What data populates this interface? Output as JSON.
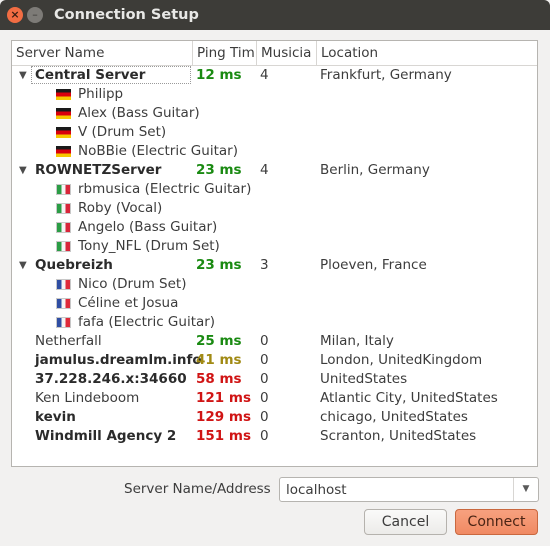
{
  "window": {
    "title": "Connection Setup",
    "close_glyph": "×",
    "min_glyph": "–"
  },
  "columns": [
    "Server Name",
    "Ping Tim",
    "Musicia",
    "Location"
  ],
  "servers": [
    {
      "name": "Central Server",
      "ping": "12 ms",
      "ping_color": "#1a8a12",
      "musicians": "4",
      "location": "Frankfurt, Germany",
      "bold": true,
      "expanded": true,
      "clients": [
        {
          "flag": "de",
          "name": "Philipp"
        },
        {
          "flag": "de",
          "name": "Alex (Bass Guitar)"
        },
        {
          "flag": "de",
          "name": "V (Drum Set)"
        },
        {
          "flag": "de",
          "name": "NoBBie (Electric Guitar)"
        }
      ]
    },
    {
      "name": "ROWNETZServer",
      "ping": "23 ms",
      "ping_color": "#1a8a12",
      "musicians": "4",
      "location": "Berlin, Germany",
      "bold": true,
      "expanded": true,
      "clients": [
        {
          "flag": "it",
          "name": "rbmusica (Electric Guitar)"
        },
        {
          "flag": "it",
          "name": "Roby (Vocal)"
        },
        {
          "flag": "it",
          "name": "Angelo (Bass Guitar)"
        },
        {
          "flag": "it",
          "name": "Tony_NFL (Drum Set)"
        }
      ]
    },
    {
      "name": "Quebreizh",
      "ping": "23 ms",
      "ping_color": "#1a8a12",
      "musicians": "3",
      "location": "Ploeven, France",
      "bold": true,
      "expanded": true,
      "clients": [
        {
          "flag": "fr",
          "name": "Nico (Drum Set)"
        },
        {
          "flag": "fr",
          "name": "Céline et Josua"
        },
        {
          "flag": "fr",
          "name": "fafa (Electric Guitar)"
        }
      ]
    },
    {
      "name": "Netherfall",
      "ping": "25 ms",
      "ping_color": "#1a8a12",
      "musicians": "0",
      "location": "Milan, Italy",
      "bold": false,
      "expanded": false,
      "clients": []
    },
    {
      "name": "jamulus.dreamlm.info",
      "ping": "41 ms",
      "ping_color": "#a18a14",
      "musicians": "0",
      "location": "London, UnitedKingdom",
      "bold": true,
      "expanded": false,
      "clients": []
    },
    {
      "name": "37.228.246.x:34660",
      "ping": "58 ms",
      "ping_color": "#d01414",
      "musicians": "0",
      "location": "UnitedStates",
      "bold": true,
      "expanded": false,
      "clients": []
    },
    {
      "name": "Ken Lindeboom",
      "ping": "121 ms",
      "ping_color": "#d01414",
      "musicians": "0",
      "location": "Atlantic City, UnitedStates",
      "bold": false,
      "expanded": false,
      "clients": []
    },
    {
      "name": "kevin",
      "ping": "129 ms",
      "ping_color": "#d01414",
      "musicians": "0",
      "location": "chicago, UnitedStates",
      "bold": true,
      "expanded": false,
      "clients": []
    },
    {
      "name": "Windmill Agency 2",
      "ping": "151 ms",
      "ping_color": "#d01414",
      "musicians": "0",
      "location": "Scranton, UnitedStates",
      "bold": true,
      "expanded": false,
      "clients": []
    }
  ],
  "address": {
    "label": "Server Name/Address",
    "value": "localhost",
    "dropdown_glyph": "▼"
  },
  "buttons": {
    "cancel": "Cancel",
    "connect": "Connect"
  },
  "icons": {
    "expanded_arrow": "▼"
  }
}
